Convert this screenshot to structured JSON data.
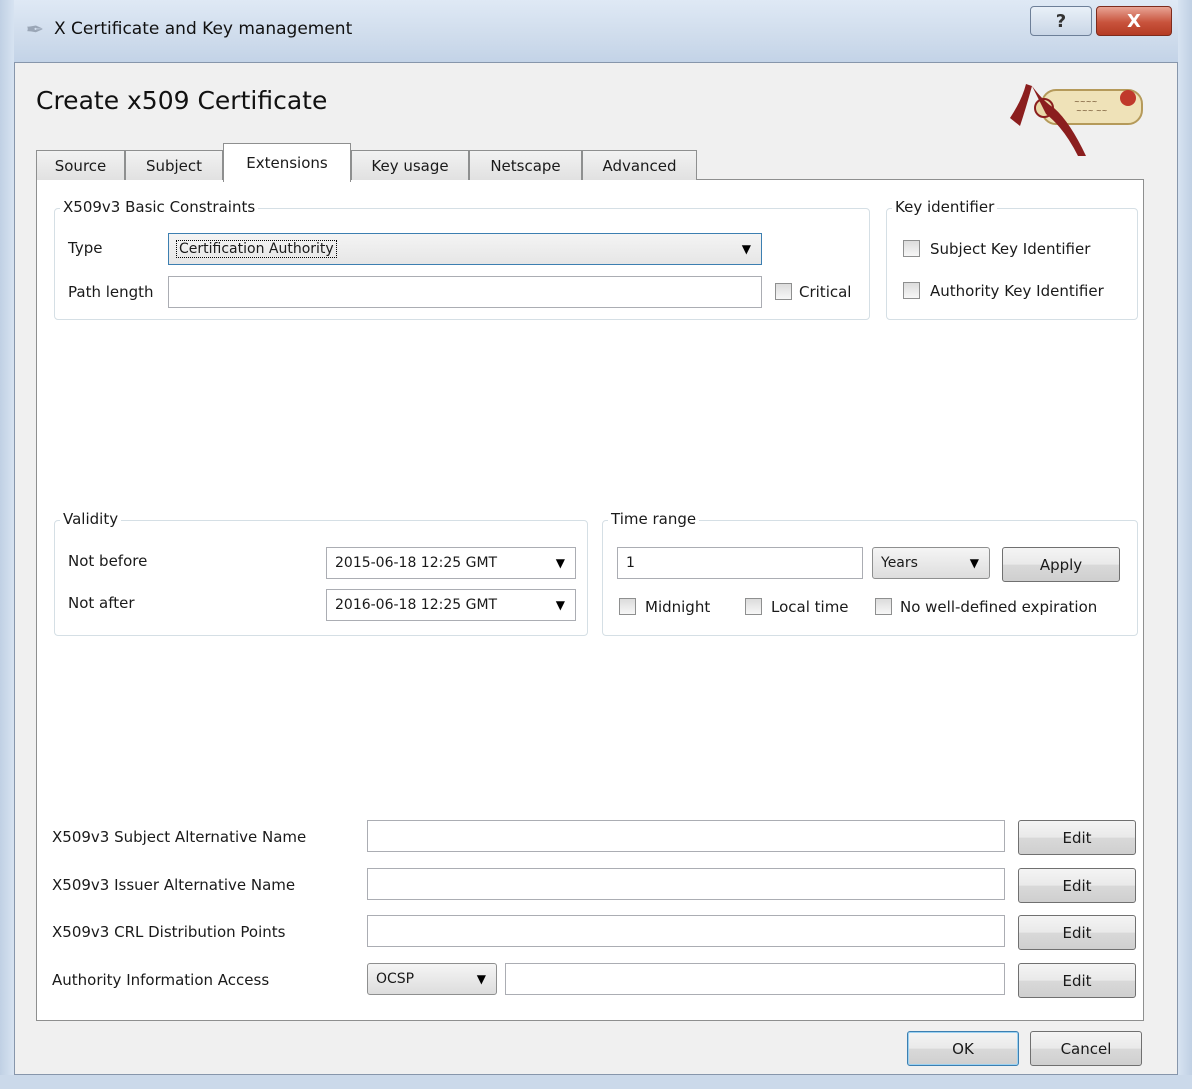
{
  "window": {
    "title": "X Certificate and Key management",
    "help_glyph": "?",
    "close_glyph": "X"
  },
  "dialog": {
    "heading": "Create x509 Certificate"
  },
  "tabs": [
    {
      "label": "Source"
    },
    {
      "label": "Subject"
    },
    {
      "label": "Extensions",
      "active": true
    },
    {
      "label": "Key usage"
    },
    {
      "label": "Netscape"
    },
    {
      "label": "Advanced"
    }
  ],
  "basic_constraints": {
    "title": "X509v3 Basic Constraints",
    "type_label": "Type",
    "type_value": "Certification Authority",
    "path_length_label": "Path length",
    "path_length_value": "",
    "critical_label": "Critical",
    "critical_checked": false
  },
  "key_identifier": {
    "title": "Key identifier",
    "subject_label": "Subject Key Identifier",
    "subject_checked": false,
    "authority_label": "Authority Key Identifier",
    "authority_checked": false
  },
  "validity": {
    "title": "Validity",
    "not_before_label": "Not before",
    "not_before_value": "2015-06-18 12:25 GMT",
    "not_after_label": "Not after",
    "not_after_value": "2016-06-18 12:25 GMT"
  },
  "time_range": {
    "title": "Time range",
    "amount": "1",
    "unit": "Years",
    "apply_label": "Apply",
    "midnight_label": "Midnight",
    "local_time_label": "Local time",
    "no_expiration_label": "No well-defined expiration"
  },
  "extensions": {
    "san_label": "X509v3 Subject Alternative Name",
    "san_value": "",
    "ian_label": "X509v3 Issuer Alternative Name",
    "ian_value": "",
    "crl_label": "X509v3 CRL Distribution Points",
    "crl_value": "",
    "aia_label": "Authority Information Access",
    "aia_method": "OCSP",
    "aia_value": "",
    "edit_label": "Edit"
  },
  "footer": {
    "ok_label": "OK",
    "cancel_label": "Cancel"
  },
  "icons": {
    "app": "pen-icon",
    "dropdown": "dropdown-arrow-icon",
    "logo": "scroll-ribbon-logo"
  },
  "colors": {
    "close_button": "#c8533c",
    "focus_border": "#3c7fb1",
    "logo_ribbon": "#8b1e1e",
    "logo_parchment": "#efe2b8"
  }
}
